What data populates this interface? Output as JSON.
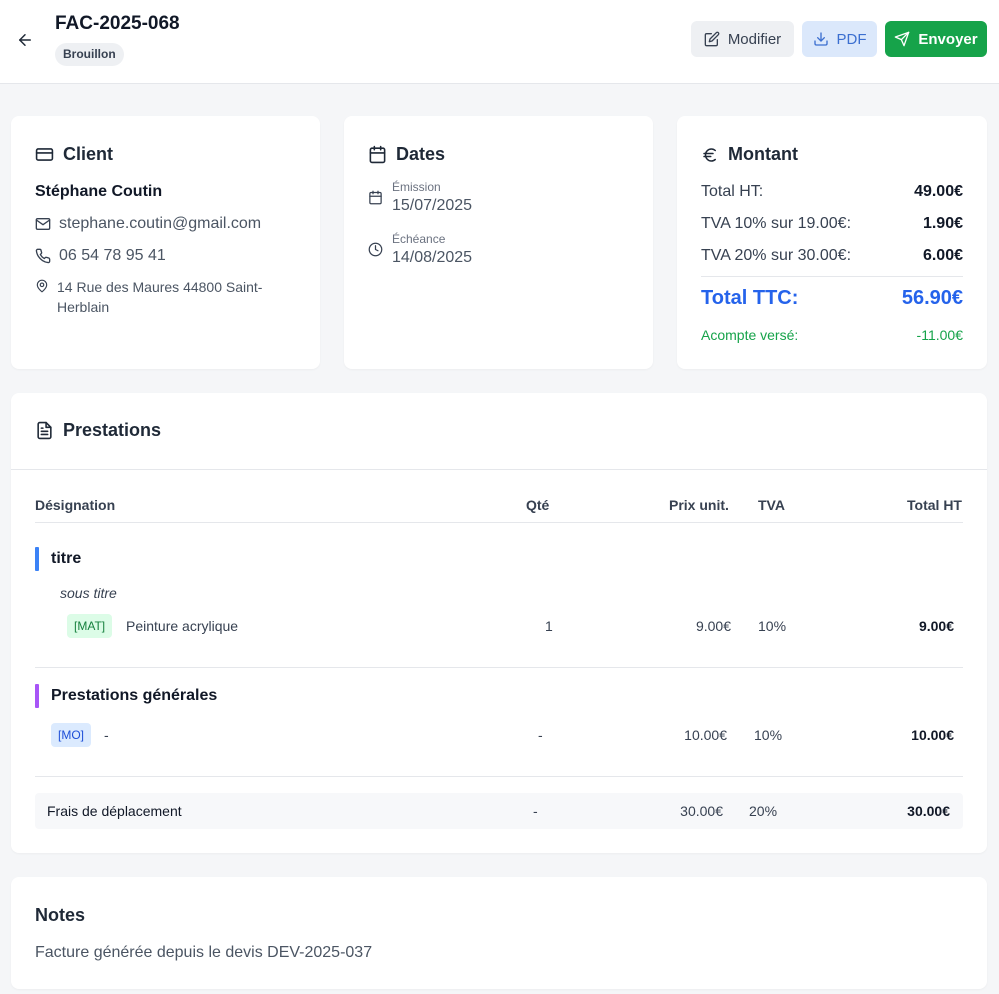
{
  "header": {
    "invoice_number": "FAC-2025-068",
    "status": "Brouillon",
    "edit_label": "Modifier",
    "pdf_label": "PDF",
    "send_label": "Envoyer"
  },
  "client": {
    "heading": "Client",
    "name": "Stéphane Coutin",
    "email": "stephane.coutin@gmail.com",
    "phone": "06 54 78 95 41",
    "address": "14 Rue des Maures 44800 Saint-Herblain"
  },
  "dates": {
    "heading": "Dates",
    "issue_label": "Émission",
    "issue_date": "15/07/2025",
    "due_label": "Échéance",
    "due_date": "14/08/2025"
  },
  "amount": {
    "heading": "Montant",
    "total_ht_label": "Total HT:",
    "total_ht": "49.00€",
    "tva10_label": "TVA 10% sur 19.00€:",
    "tva10": "1.90€",
    "tva20_label": "TVA 20% sur 30.00€:",
    "tva20": "6.00€",
    "total_ttc_label": "Total TTC:",
    "total_ttc": "56.90€",
    "deposit_label": "Acompte versé:",
    "deposit": "-11.00€"
  },
  "services": {
    "heading": "Prestations",
    "columns": {
      "designation": "Désignation",
      "qty": "Qté",
      "unit_price": "Prix unit.",
      "tva": "TVA",
      "total_ht": "Total HT"
    },
    "sections": [
      {
        "title": "titre",
        "accent": "#3b82f6",
        "subtitle": "sous titre",
        "rows": [
          {
            "tag": "[MAT]",
            "label": "Peinture acrylique",
            "qty": "1",
            "unit_price": "9.00€",
            "tva": "10%",
            "total": "9.00€"
          }
        ]
      },
      {
        "title": "Prestations générales",
        "accent": "#a855f7",
        "rows": [
          {
            "tag": "[MO]",
            "label": "-",
            "qty": "-",
            "unit_price": "10.00€",
            "tva": "10%",
            "total": "10.00€"
          }
        ]
      }
    ],
    "travel": {
      "label": "Frais de déplacement",
      "qty": "-",
      "unit_price": "30.00€",
      "tva": "20%",
      "total": "30.00€"
    }
  },
  "notes": {
    "heading": "Notes",
    "text": "Facture générée depuis le devis DEV-2025-037"
  },
  "colors": {
    "accent_blue": "#2563eb",
    "send_green": "#16a34a",
    "deposit_green": "#16a34a",
    "section1_bar": "#3b82f6",
    "section2_bar": "#a855f7"
  },
  "icons": {
    "back": "arrow-left-icon",
    "edit": "pencil-square-icon",
    "pdf": "download-icon",
    "send": "paper-plane-icon",
    "client": "credit-card-icon",
    "dates": "calendar-icon",
    "amount": "euro-icon",
    "email": "mail-icon",
    "phone": "phone-icon",
    "address": "map-pin-icon",
    "issue": "calendar-small-icon",
    "due": "clock-icon",
    "services": "document-icon"
  }
}
